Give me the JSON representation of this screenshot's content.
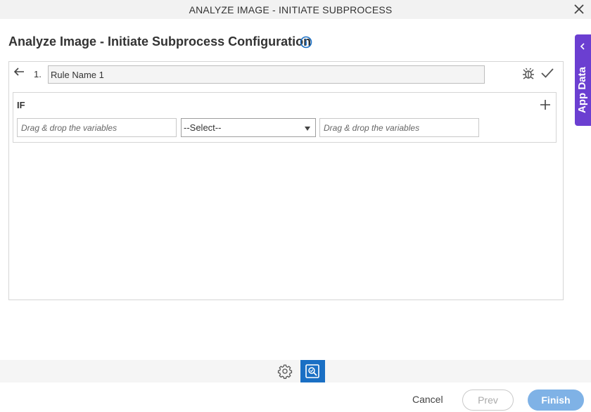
{
  "dialog": {
    "title": "ANALYZE IMAGE - INITIATE SUBPROCESS",
    "close_icon": "close-icon"
  },
  "page": {
    "title": "Analyze Image - Initiate Subprocess Configuration",
    "info_icon": "info-icon"
  },
  "side_tab": {
    "label": "App Data",
    "icon": "chevron-left-icon",
    "color": "#6b3fd1"
  },
  "rule": {
    "number": "1.",
    "name_value": "Rule Name 1",
    "back_icon": "arrow-left-icon",
    "debug_icon": "bug-icon",
    "confirm_icon": "check-icon"
  },
  "condition": {
    "label": "IF",
    "add_icon": "plus-icon",
    "left_placeholder": "Drag & drop the variables",
    "operator_selected": "--Select--",
    "right_placeholder": "Drag & drop the variables"
  },
  "toolbar": {
    "settings_icon": "gear-icon",
    "analyze_icon": "analyze-image-icon",
    "active_color": "#1a6fc4"
  },
  "footer": {
    "cancel_label": "Cancel",
    "prev_label": "Prev",
    "finish_label": "Finish",
    "finish_color": "#7fb2e6"
  }
}
